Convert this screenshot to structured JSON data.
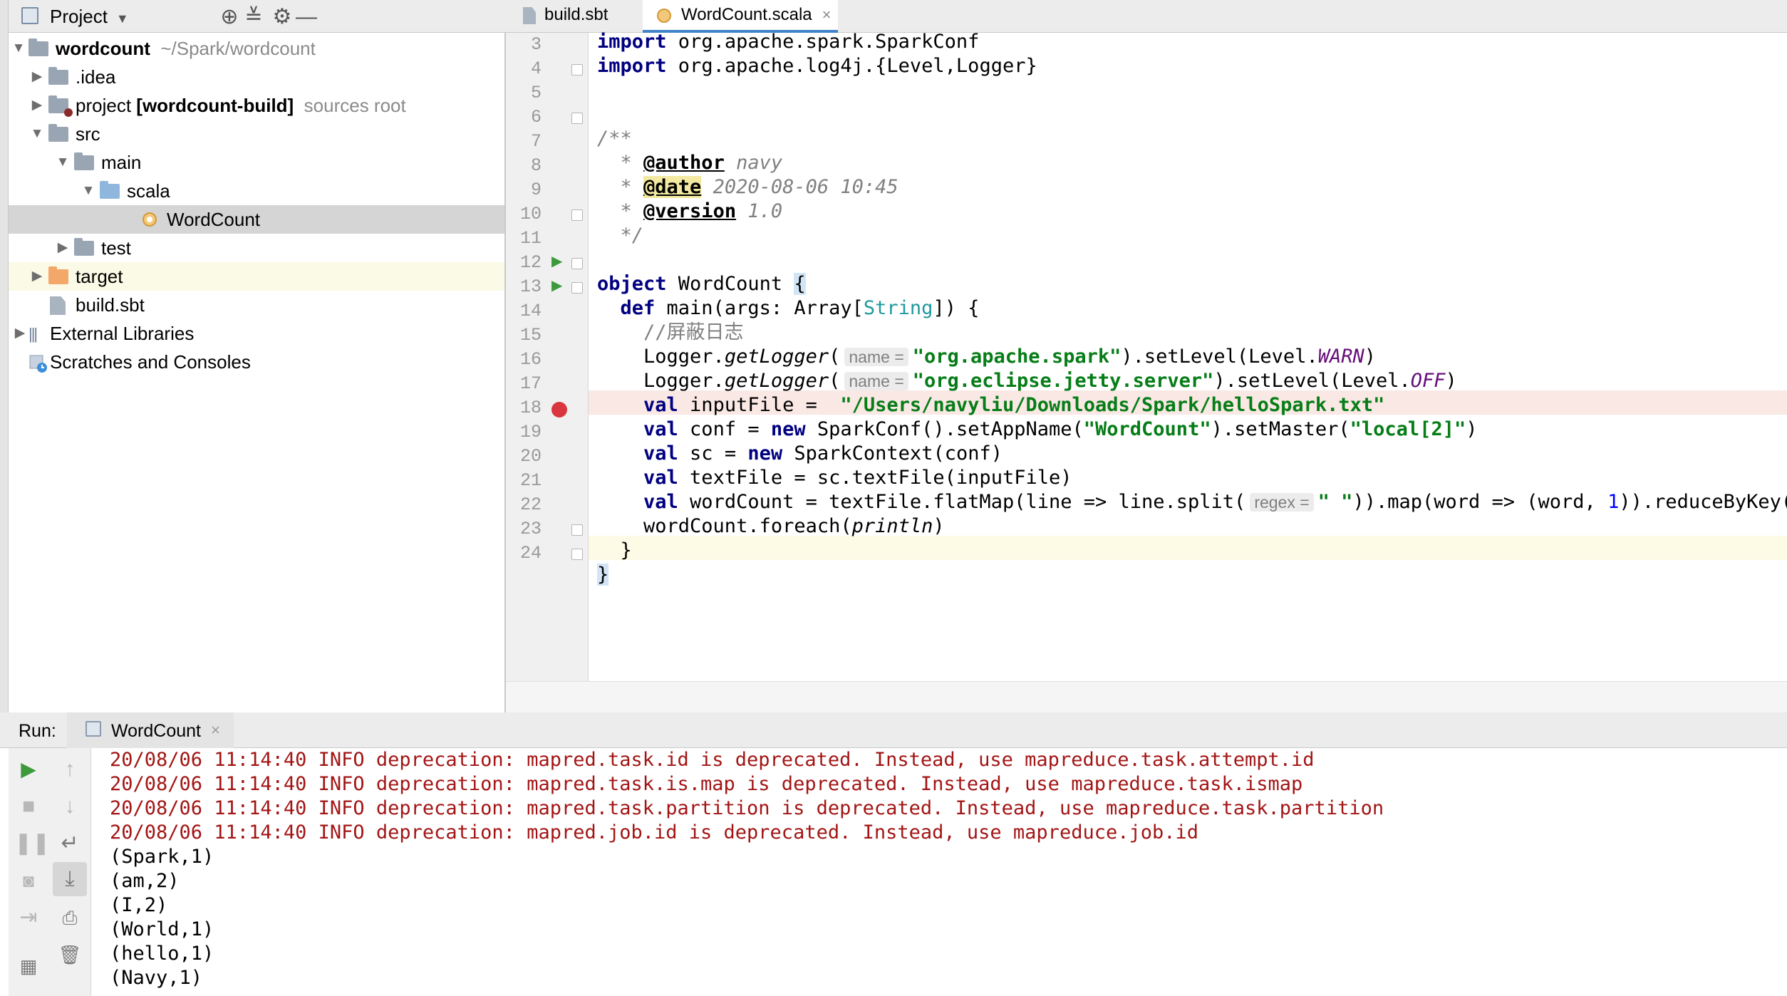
{
  "project_panel": {
    "title": "Project",
    "tree": [
      {
        "label": "wordcount",
        "extra": "~/Spark/wordcount"
      },
      {
        "label": ".idea"
      },
      {
        "label": "project",
        "bold_extra": "[wordcount-build]",
        "extra": "sources root"
      },
      {
        "label": "src"
      },
      {
        "label": "main"
      },
      {
        "label": "scala"
      },
      {
        "label": "WordCount"
      },
      {
        "label": "test"
      },
      {
        "label": "target"
      },
      {
        "label": "build.sbt"
      },
      {
        "label": "External Libraries"
      },
      {
        "label": "Scratches and Consoles"
      }
    ]
  },
  "editor": {
    "tabs": [
      {
        "label": "build.sbt"
      },
      {
        "label": "WordCount.scala",
        "close": "×"
      }
    ],
    "line_numbers": [
      "3",
      "4",
      "5",
      "6",
      "7",
      "8",
      "9",
      "10",
      "11",
      "12",
      "13",
      "14",
      "15",
      "16",
      "17",
      "18",
      "19",
      "20",
      "21",
      "22",
      "23",
      "24"
    ],
    "code": {
      "l3_kw": "import",
      "l3_rest": " org.apache.spark.SparkConf",
      "l4_kw": "import",
      "l4_rest": " org.apache.log4j.{Level,Logger}",
      "l6": "/**",
      "l7_star": "  * ",
      "l7_tag": "@author",
      "l7_val": " navy",
      "l8_star": "  * ",
      "l8_tag": "@date",
      "l8_val": " 2020-08-06 10:45",
      "l9_star": "  * ",
      "l9_tag": "@version",
      "l9_val": " 1.0",
      "l10": "  */",
      "l12_kw": "object",
      "l12_rest": " WordCount ",
      "l12_brace": "{",
      "l13_kw": "  def",
      "l13_a": " main(args: Array[",
      "l13_type": "String",
      "l13_b": "]) {",
      "l14": "    //屏蔽日志",
      "l15_a": "    Logger.",
      "l15_fn": "getLogger",
      "l15_b": "(",
      "l15_hint": "name =",
      "l15_str": "\"org.apache.spark\"",
      "l15_c": ").setLevel(Level.",
      "l15_const": "WARN",
      "l15_d": ")",
      "l16_a": "    Logger.",
      "l16_fn": "getLogger",
      "l16_b": "(",
      "l16_hint": "name =",
      "l16_str": "\"org.eclipse.jetty.server\"",
      "l16_c": ").setLevel(Level.",
      "l16_const": "OFF",
      "l16_d": ")",
      "l17_kw": "    val",
      "l17_a": " inputFile =  ",
      "l17_str": "\"/Users/navyliu/Downloads/Spark/helloSpark.txt\"",
      "l18_kw": "    val",
      "l18_a": " conf = ",
      "l18_kw2": "new",
      "l18_b": " SparkConf().setAppName(",
      "l18_str1": "\"WordCount\"",
      "l18_c": ").setMaster(",
      "l18_str2": "\"local[2]\"",
      "l18_d": ")",
      "l19_kw": "    val",
      "l19_a": " sc = ",
      "l19_kw2": "new",
      "l19_b": " SparkContext(conf)",
      "l20_kw": "    val",
      "l20_a": " textFile = sc.textFile(inputFile)",
      "l21_kw": "    val",
      "l21_a": " wordCount = textFile.flatMap(line => line.split(",
      "l21_hint": "regex =",
      "l21_str": "\" \"",
      "l21_b": ")).map(word => (word, ",
      "l21_num": "1",
      "l21_c": ")).reduceByKey(",
      "l22_a": "    wordCount.foreach(",
      "l22_fn": "println",
      "l22_b": ")",
      "l23": "  }",
      "l24": "}"
    }
  },
  "run_panel": {
    "title": "Run:",
    "tab_label": "WordCount",
    "tab_close": "×",
    "console": [
      "20/08/06 11:14:40 INFO deprecation: mapred.task.id is deprecated. Instead, use mapreduce.task.attempt.id",
      "20/08/06 11:14:40 INFO deprecation: mapred.task.is.map is deprecated. Instead, use mapreduce.task.ismap",
      "20/08/06 11:14:40 INFO deprecation: mapred.task.partition is deprecated. Instead, use mapreduce.task.partition",
      "20/08/06 11:14:40 INFO deprecation: mapred.job.id is deprecated. Instead, use mapreduce.job.id",
      "(Spark,1)",
      "(am,2)",
      "(I,2)",
      "(World,1)",
      "(hello,1)",
      "(Navy,1)"
    ]
  },
  "icons": {
    "breakpoint_color": "#d9363e",
    "run_color": "#3c9a3c",
    "selection_color": "#d5d5d5"
  }
}
